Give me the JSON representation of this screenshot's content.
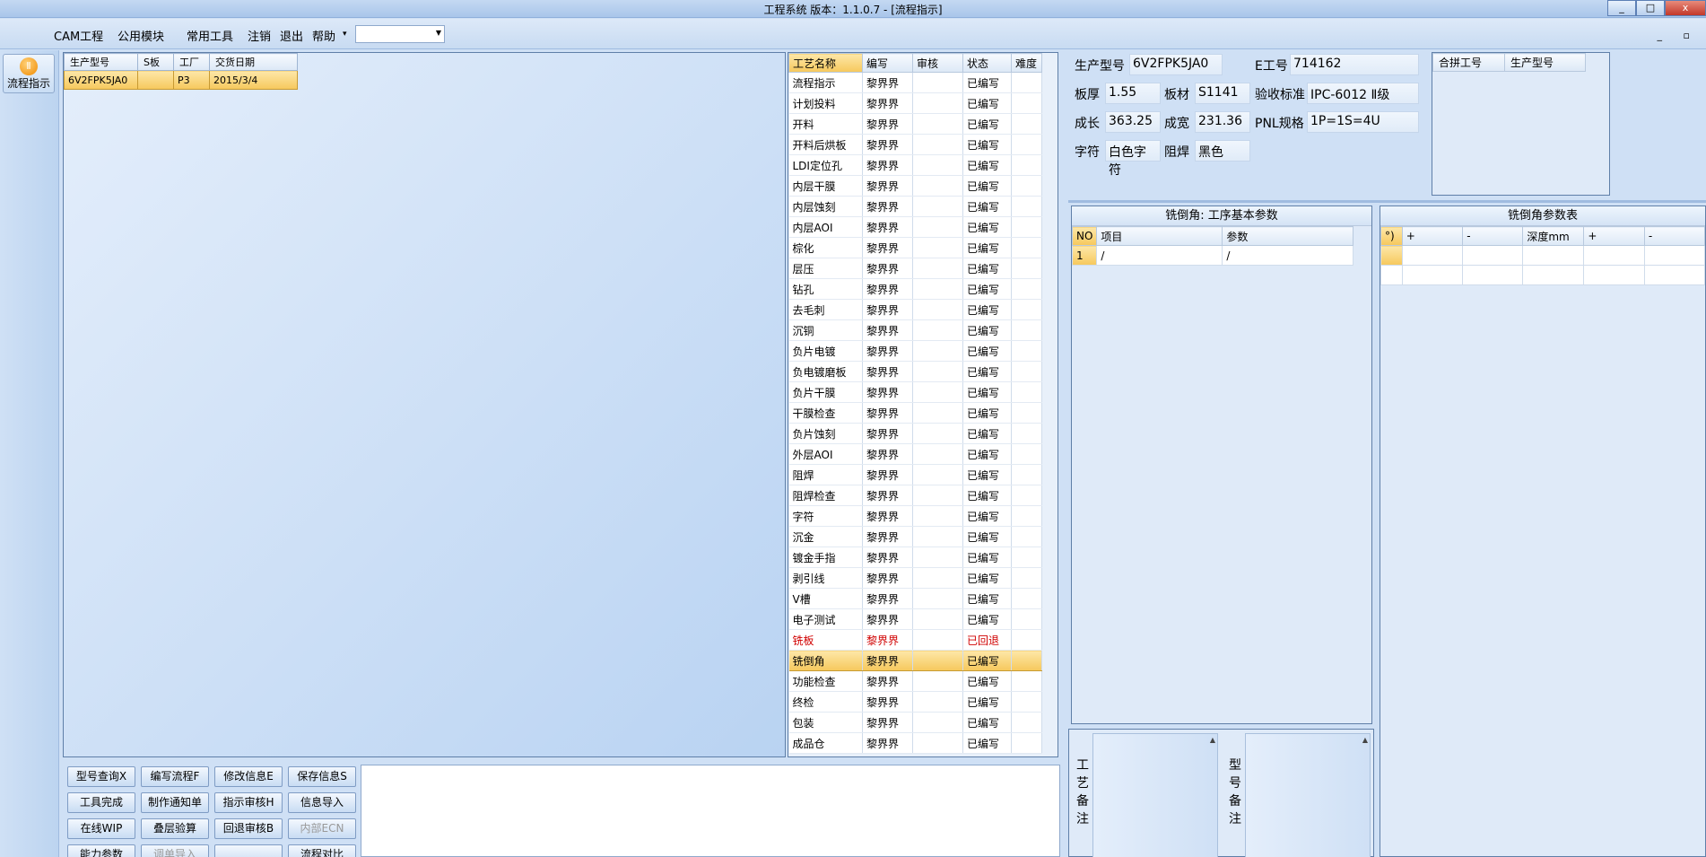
{
  "window": {
    "title": "工程系统   版本：1.1.0.7 - [流程指示]",
    "controls": [
      "_",
      "□",
      "x"
    ]
  },
  "menu": {
    "items": [
      "CAM工程",
      "公用模块",
      "常用工具",
      "注销",
      "退出",
      "帮助"
    ],
    "help_arrow": "▾",
    "combo_value": "",
    "mdi_controls": "_ ▫"
  },
  "left_toolbar": {
    "flow_button_label": "流程指示"
  },
  "order_grid": {
    "headers": [
      "生产型号",
      "S板",
      "工厂",
      "交货日期"
    ],
    "rows": [
      [
        "6V2FPK5JA0",
        "",
        "P3",
        "2015/3/4"
      ]
    ]
  },
  "process_table": {
    "headers": [
      "工艺名称",
      "编写",
      "审核",
      "状态",
      "难度"
    ],
    "rows": [
      {
        "name": "流程指示",
        "writer": "黎界界",
        "review": "",
        "status": "已编写",
        "diff": ""
      },
      {
        "name": "计划投料",
        "writer": "黎界界",
        "review": "",
        "status": "已编写",
        "diff": ""
      },
      {
        "name": "开料",
        "writer": "黎界界",
        "review": "",
        "status": "已编写",
        "diff": ""
      },
      {
        "name": "开料后烘板",
        "writer": "黎界界",
        "review": "",
        "status": "已编写",
        "diff": ""
      },
      {
        "name": "LDI定位孔",
        "writer": "黎界界",
        "review": "",
        "status": "已编写",
        "diff": ""
      },
      {
        "name": "内层干膜",
        "writer": "黎界界",
        "review": "",
        "status": "已编写",
        "diff": ""
      },
      {
        "name": "内层蚀刻",
        "writer": "黎界界",
        "review": "",
        "status": "已编写",
        "diff": ""
      },
      {
        "name": "内层AOI",
        "writer": "黎界界",
        "review": "",
        "status": "已编写",
        "diff": ""
      },
      {
        "name": "棕化",
        "writer": "黎界界",
        "review": "",
        "status": "已编写",
        "diff": ""
      },
      {
        "name": "层压",
        "writer": "黎界界",
        "review": "",
        "status": "已编写",
        "diff": ""
      },
      {
        "name": "钻孔",
        "writer": "黎界界",
        "review": "",
        "status": "已编写",
        "diff": ""
      },
      {
        "name": "去毛刺",
        "writer": "黎界界",
        "review": "",
        "status": "已编写",
        "diff": ""
      },
      {
        "name": "沉铜",
        "writer": "黎界界",
        "review": "",
        "status": "已编写",
        "diff": ""
      },
      {
        "name": "负片电镀",
        "writer": "黎界界",
        "review": "",
        "status": "已编写",
        "diff": ""
      },
      {
        "name": "负电镀磨板",
        "writer": "黎界界",
        "review": "",
        "status": "已编写",
        "diff": ""
      },
      {
        "name": "负片干膜",
        "writer": "黎界界",
        "review": "",
        "status": "已编写",
        "diff": ""
      },
      {
        "name": "干膜检查",
        "writer": "黎界界",
        "review": "",
        "status": "已编写",
        "diff": ""
      },
      {
        "name": "负片蚀刻",
        "writer": "黎界界",
        "review": "",
        "status": "已编写",
        "diff": ""
      },
      {
        "name": "外层AOI",
        "writer": "黎界界",
        "review": "",
        "status": "已编写",
        "diff": ""
      },
      {
        "name": "阻焊",
        "writer": "黎界界",
        "review": "",
        "status": "已编写",
        "diff": ""
      },
      {
        "name": "阻焊检查",
        "writer": "黎界界",
        "review": "",
        "status": "已编写",
        "diff": ""
      },
      {
        "name": "字符",
        "writer": "黎界界",
        "review": "",
        "status": "已编写",
        "diff": ""
      },
      {
        "name": "沉金",
        "writer": "黎界界",
        "review": "",
        "status": "已编写",
        "diff": ""
      },
      {
        "name": "镀金手指",
        "writer": "黎界界",
        "review": "",
        "status": "已编写",
        "diff": ""
      },
      {
        "name": "剥引线",
        "writer": "黎界界",
        "review": "",
        "status": "已编写",
        "diff": ""
      },
      {
        "name": "V槽",
        "writer": "黎界界",
        "review": "",
        "status": "已编写",
        "diff": ""
      },
      {
        "name": "电子测试",
        "writer": "黎界界",
        "review": "",
        "status": "已编写",
        "diff": ""
      },
      {
        "name": "铣板",
        "writer": "黎界界",
        "review": "",
        "status": "已回退",
        "diff": "",
        "state": "red"
      },
      {
        "name": "铣倒角",
        "writer": "黎界界",
        "review": "",
        "status": "已编写",
        "diff": "",
        "state": "sel"
      },
      {
        "name": "功能检查",
        "writer": "黎界界",
        "review": "",
        "status": "已编写",
        "diff": ""
      },
      {
        "name": "终检",
        "writer": "黎界界",
        "review": "",
        "status": "已编写",
        "diff": ""
      },
      {
        "name": "包装",
        "writer": "黎界界",
        "review": "",
        "status": "已编写",
        "diff": ""
      },
      {
        "name": "成品仓",
        "writer": "黎界界",
        "review": "",
        "status": "已编写",
        "diff": ""
      }
    ]
  },
  "buttons": [
    [
      "型号查询X",
      "编写流程F",
      "修改信息E",
      "保存信息S"
    ],
    [
      "工具完成",
      "制作通知单",
      "指示审核H",
      "信息导入"
    ],
    [
      "在线WIP",
      "叠层验算",
      "回退审核B",
      "内部ECN"
    ],
    [
      "能力参数",
      "调单导入",
      "",
      "流程对比"
    ]
  ],
  "info": {
    "prod_model_label": "生产型号",
    "prod_model": "6V2FPK5JA0",
    "e_no_label": "E工号",
    "e_no": "714162",
    "thick_label": "板厚",
    "thick": "1.55",
    "material_label": "板材",
    "material": "S1141",
    "std_label": "验收标准",
    "std": "IPC-6012 Ⅱ级",
    "len_label": "成长",
    "len": "363.25",
    "wid_label": "成宽",
    "wid": "231.36",
    "pnl_label": "PNL规格",
    "pnl": "1P=1S=4U",
    "char_label": "字符",
    "char": "白色字符",
    "mask_label": "阻焊",
    "mask": "黑色"
  },
  "combine_table": {
    "headers": [
      "合拼工号",
      "生产型号"
    ]
  },
  "basic_params": {
    "title": "铣倒角: 工序基本参数",
    "headers": [
      "NO",
      "项目",
      "参数"
    ],
    "rows": [
      [
        "1",
        "/",
        "/"
      ]
    ]
  },
  "bevel_params": {
    "title": "铣倒角参数表",
    "headers": [
      "°)",
      "+",
      "-",
      "深度mm",
      "+",
      "-"
    ]
  },
  "notes": {
    "process_note_label": "工艺备注",
    "model_note_label": "型号备注"
  }
}
